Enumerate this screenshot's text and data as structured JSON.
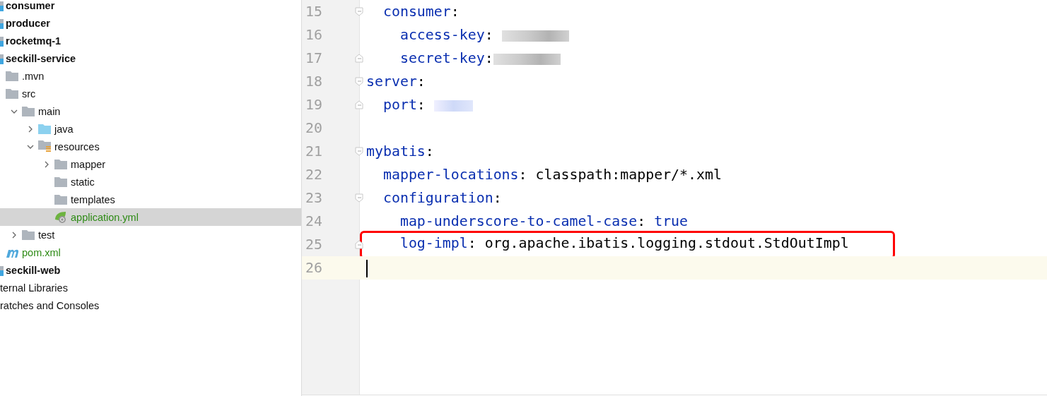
{
  "project_tree": [
    {
      "label": "consumer",
      "kind": "module"
    },
    {
      "label": "producer",
      "kind": "module"
    },
    {
      "label": "rocketmq-1",
      "kind": "module"
    },
    {
      "label": "seckill-service",
      "kind": "module",
      "children": [
        {
          "label": ".mvn",
          "kind": "folder"
        },
        {
          "label": "src",
          "kind": "folder",
          "children": [
            {
              "label": "main",
              "kind": "folder",
              "expanded": true,
              "children": [
                {
                  "label": "java",
                  "kind": "source-folder",
                  "expanded": false
                },
                {
                  "label": "resources",
                  "kind": "resources-folder",
                  "expanded": true,
                  "children": [
                    {
                      "label": "mapper",
                      "kind": "folder",
                      "expanded": false
                    },
                    {
                      "label": "static",
                      "kind": "folder"
                    },
                    {
                      "label": "templates",
                      "kind": "folder"
                    },
                    {
                      "label": "application.yml",
                      "kind": "spring-file",
                      "selected": true
                    }
                  ]
                }
              ]
            },
            {
              "label": "test",
              "kind": "folder",
              "expanded": false
            }
          ]
        },
        {
          "label": "pom.xml",
          "kind": "maven-file",
          "selected": false
        }
      ]
    },
    {
      "label": "seckill-web",
      "kind": "module"
    },
    {
      "label": "ternal Libraries",
      "kind": "cut"
    },
    {
      "label": "ratches and Consoles",
      "kind": "cut"
    }
  ],
  "editor": {
    "lines": [
      {
        "number": "15",
        "fold_start": true,
        "segments": [
          {
            "kind": "key",
            "text": "  consumer"
          },
          {
            "kind": "punct",
            "text": ":"
          }
        ]
      },
      {
        "number": "16",
        "segments": [
          {
            "kind": "key",
            "text": "    access-key"
          },
          {
            "kind": "punct",
            "text": ": "
          }
        ],
        "redacted": true
      },
      {
        "number": "17",
        "fold_end": true,
        "segments": [
          {
            "kind": "key",
            "text": "    secret-key"
          },
          {
            "kind": "punct",
            "text": ":"
          }
        ],
        "redacted": true
      },
      {
        "number": "18",
        "fold_start": true,
        "segments": [
          {
            "kind": "key",
            "text": "server"
          },
          {
            "kind": "punct",
            "text": ":"
          }
        ]
      },
      {
        "number": "19",
        "fold_end": true,
        "segments": [
          {
            "kind": "key",
            "text": "  port"
          },
          {
            "kind": "punct",
            "text": ": "
          }
        ],
        "redacted": true
      },
      {
        "number": "20"
      },
      {
        "number": "21",
        "fold_start": true,
        "segments": [
          {
            "kind": "key",
            "text": "mybatis"
          },
          {
            "kind": "punct",
            "text": ":"
          }
        ]
      },
      {
        "number": "22",
        "segments": [
          {
            "kind": "key",
            "text": "  mapper-locations"
          },
          {
            "kind": "punct",
            "text": ": "
          },
          {
            "kind": "value",
            "text": "classpath:mapper/*.xml"
          }
        ]
      },
      {
        "number": "23",
        "fold_start": true,
        "segments": [
          {
            "kind": "key",
            "text": "  configuration"
          },
          {
            "kind": "punct",
            "text": ":"
          }
        ]
      },
      {
        "number": "24",
        "segments": [
          {
            "kind": "key",
            "text": "    map-underscore-to-camel-case"
          },
          {
            "kind": "punct",
            "text": ": "
          },
          {
            "kind": "keyword",
            "text": "true"
          }
        ]
      },
      {
        "number": "25",
        "fold_end": true,
        "highlighted": true,
        "segments": [
          {
            "kind": "key",
            "text": "    log-impl"
          },
          {
            "kind": "punct",
            "text": ": "
          },
          {
            "kind": "value",
            "text": "org.apache.ibatis.logging.stdout.StdOutImpl"
          }
        ]
      },
      {
        "number": "26",
        "current": true
      }
    ]
  }
}
